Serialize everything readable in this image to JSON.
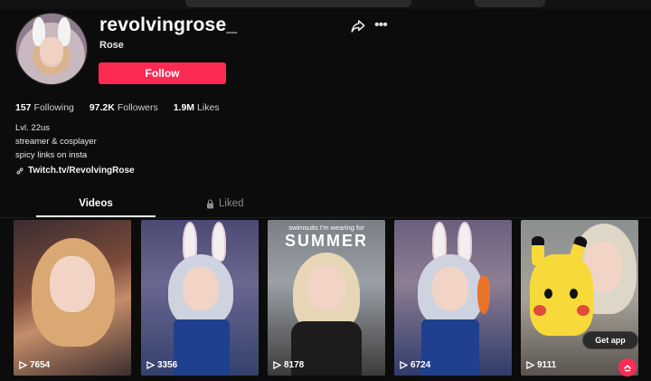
{
  "profile": {
    "username": "revolvingrose_",
    "nickname": "Rose",
    "follow_label": "Follow",
    "stats": {
      "following_count": "157",
      "following_label": "Following",
      "followers_count": "97.2K",
      "followers_label": "Followers",
      "likes_count": "1.9M",
      "likes_label": "Likes"
    },
    "bio": [
      "Lvl. 22us",
      "streamer & cosplayer",
      "spicy links on insta"
    ],
    "link": "Twitch.tv/RevolvingRose"
  },
  "tabs": {
    "videos": "Videos",
    "liked": "Liked"
  },
  "videos": [
    {
      "views": "7654",
      "overlay": ""
    },
    {
      "views": "3356",
      "overlay": ""
    },
    {
      "views": "8178",
      "overlay_small": "swimsuits I'm wearing for",
      "overlay_big": "SUMMER"
    },
    {
      "views": "6724",
      "overlay": ""
    },
    {
      "views": "9111",
      "overlay": ""
    }
  ],
  "get_app_label": "Get app",
  "colors": {
    "accent": "#fe2c55",
    "background": "#0c0c0c"
  },
  "icons": [
    "share-icon",
    "more-icon",
    "link-icon",
    "lock-icon",
    "play-icon",
    "arrow-up-icon"
  ]
}
